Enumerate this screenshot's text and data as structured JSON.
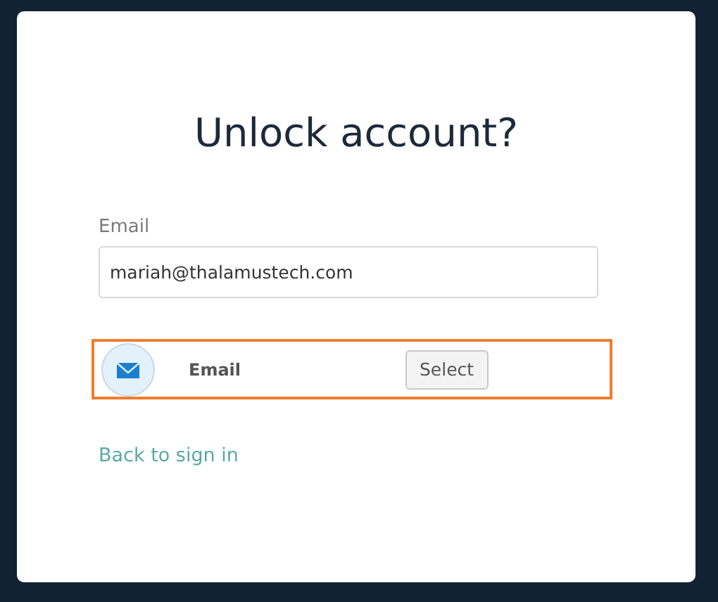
{
  "title": "Unlock account?",
  "email_field": {
    "label": "Email",
    "value": "mariah@thalamustech.com"
  },
  "factors": [
    {
      "label": "Email",
      "button": "Select",
      "highlighted": true
    }
  ],
  "back_link": "Back to sign in"
}
